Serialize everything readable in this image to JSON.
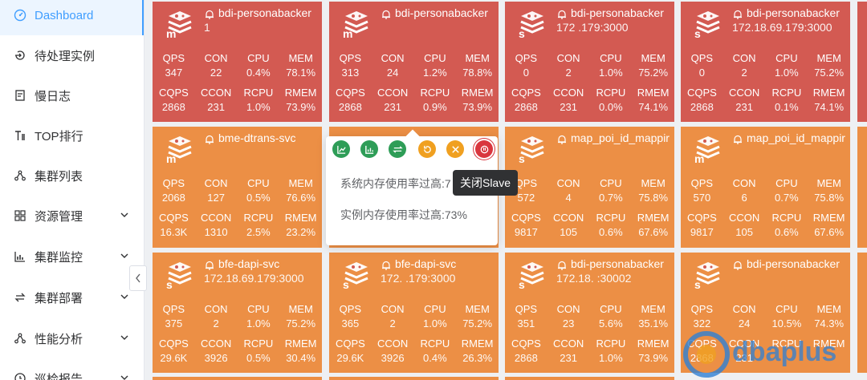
{
  "sidebar": {
    "items": [
      {
        "label": "Dashboard",
        "icon": "dashboard-icon",
        "active": true
      },
      {
        "label": "待处理实例",
        "icon": "pending-icon"
      },
      {
        "label": "慢日志",
        "icon": "log-icon"
      },
      {
        "label": "TOP排行",
        "icon": "rank-icon"
      },
      {
        "label": "集群列表",
        "icon": "cluster-icon"
      },
      {
        "label": "资源管理",
        "icon": "resource-icon",
        "expand": true
      },
      {
        "label": "集群监控",
        "icon": "monitor-icon",
        "expand": true
      },
      {
        "label": "集群部署",
        "icon": "deploy-icon",
        "expand": true
      },
      {
        "label": "性能分析",
        "icon": "perf-icon",
        "expand": true
      },
      {
        "label": "巡检报告",
        "icon": "report-icon",
        "expand": true
      }
    ]
  },
  "labels": {
    "qps": "QPS",
    "con": "CON",
    "cpu": "CPU",
    "mem": "MEM",
    "cqps": "CQPS",
    "ccon": "CCON",
    "rcpu": "RCPU",
    "rmem": "RMEM"
  },
  "cards": [
    {
      "name": "bdi-personabacker",
      "addr": "1",
      "role": "m",
      "color": "red",
      "qps": "347",
      "con": "22",
      "cpu": "0.4%",
      "mem": "78.1%",
      "cqps": "2868",
      "ccon": "231",
      "rcpu": "1.0%",
      "rmem": "73.9%"
    },
    {
      "name": "bdi-personabacker",
      "addr": "",
      "role": "m",
      "color": "red",
      "qps": "313",
      "con": "24",
      "cpu": "1.2%",
      "mem": "78.8%",
      "cqps": "2868",
      "ccon": "231",
      "rcpu": "0.9%",
      "rmem": "73.9%"
    },
    {
      "name": "bdi-personabacker",
      "addr": "172 .179:3000",
      "role": "s",
      "color": "red",
      "qps": "0",
      "con": "2",
      "cpu": "1.0%",
      "mem": "75.2%",
      "cqps": "2868",
      "ccon": "231",
      "rcpu": "0.0%",
      "rmem": "74.1%"
    },
    {
      "name": "bdi-personabacker",
      "addr": "172.18.69.179:3000",
      "role": "s",
      "color": "red",
      "qps": "0",
      "con": "2",
      "cpu": "1.0%",
      "mem": "75.2%",
      "cqps": "2868",
      "ccon": "231",
      "rcpu": "0.1%",
      "rmem": "74.1%"
    },
    {
      "name": "bme-dtrans-svc",
      "addr": "",
      "role": "m",
      "color": "orange",
      "qps": "2068",
      "con": "127",
      "cpu": "0.5%",
      "mem": "76.6%",
      "cqps": "16.3K",
      "ccon": "1310",
      "rcpu": "2.5%",
      "rmem": "23.2%"
    },
    {
      "name": "",
      "addr": "",
      "role": "",
      "color": "orange",
      "qps": "",
      "con": "",
      "cpu": "",
      "mem": "",
      "cqps": "",
      "ccon": "",
      "rcpu": "",
      "rmem": ""
    },
    {
      "name": "map_poi_id_mappir",
      "addr": "",
      "role": "s",
      "color": "orange",
      "qps": "572",
      "con": "4",
      "cpu": "0.7%",
      "mem": "75.8%",
      "cqps": "9817",
      "ccon": "105",
      "rcpu": "0.6%",
      "rmem": "67.6%"
    },
    {
      "name": "map_poi_id_mappir",
      "addr": "",
      "role": "m",
      "color": "orange",
      "qps": "570",
      "con": "6",
      "cpu": "0.7%",
      "mem": "75.8%",
      "cqps": "9817",
      "ccon": "105",
      "rcpu": "0.6%",
      "rmem": "67.6%"
    },
    {
      "name": "bfe-dapi-svc",
      "addr": "172.18.69.179:3000",
      "role": "s",
      "color": "orange",
      "qps": "375",
      "con": "2",
      "cpu": "1.0%",
      "mem": "75.2%",
      "cqps": "29.6K",
      "ccon": "3926",
      "rcpu": "0.5%",
      "rmem": "30.4%"
    },
    {
      "name": "bfe-dapi-svc",
      "addr": "172. .179:3000",
      "role": "s",
      "color": "orange",
      "qps": "365",
      "con": "2",
      "cpu": "1.0%",
      "mem": "75.2%",
      "cqps": "29.6K",
      "ccon": "3926",
      "rcpu": "0.4%",
      "rmem": "26.3%"
    },
    {
      "name": "bdi-personabacker",
      "addr": "172.18. :30002",
      "role": "s",
      "color": "orange",
      "qps": "351",
      "con": "23",
      "cpu": "5.6%",
      "mem": "35.1%",
      "cqps": "2868",
      "ccon": "231",
      "rcpu": "1.0%",
      "rmem": "73.9%"
    },
    {
      "name": "bdi-personabacker",
      "addr": "",
      "role": "s",
      "color": "orange",
      "qps": "322",
      "con": "24",
      "cpu": "10.5%",
      "mem": "74.3%",
      "cqps": "2868",
      "ccon": "231",
      "rcpu": "",
      "rmem": ""
    }
  ],
  "popover": {
    "actions": [
      {
        "icon": "line-chart-icon",
        "color": "#2e9d57"
      },
      {
        "icon": "bar-chart-icon",
        "color": "#2e9d57"
      },
      {
        "icon": "switch-icon",
        "color": "#2e9d57"
      },
      {
        "icon": "restore-icon",
        "color": "#f0a020"
      },
      {
        "icon": "close-icon",
        "color": "#f0a020"
      },
      {
        "icon": "power-icon",
        "color": "#d9363e"
      }
    ],
    "messages": [
      "系统内存使用率过高:7",
      "实例内存使用率过高:73%"
    ],
    "tooltip": "关闭Slave"
  },
  "watermark": "dbaplus"
}
